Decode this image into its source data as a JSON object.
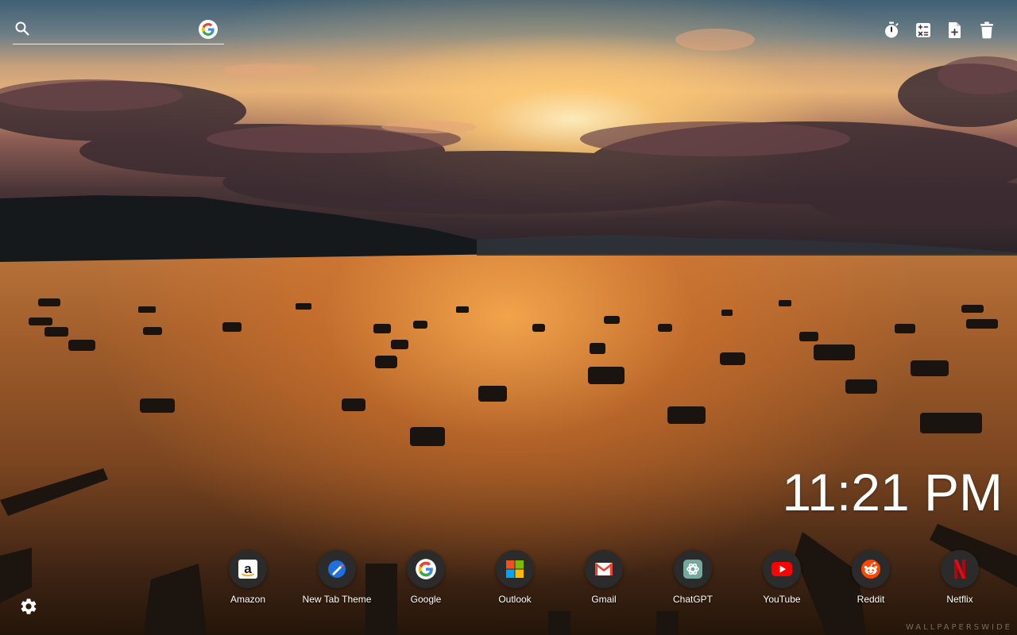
{
  "search": {
    "placeholder": "",
    "value": "",
    "engine_icon": "google-g-icon"
  },
  "toolbar": {
    "items": [
      {
        "icon": "stopwatch-icon"
      },
      {
        "icon": "calculator-icon"
      },
      {
        "icon": "add-note-icon"
      },
      {
        "icon": "trash-icon"
      }
    ]
  },
  "clock": {
    "time": "11:21 PM"
  },
  "shortcuts": [
    {
      "label": "Amazon",
      "icon": "amazon-icon"
    },
    {
      "label": "New Tab Theme",
      "icon": "new-tab-theme-icon"
    },
    {
      "label": "Google",
      "icon": "google-icon"
    },
    {
      "label": "Outlook",
      "icon": "outlook-icon"
    },
    {
      "label": "Gmail",
      "icon": "gmail-icon"
    },
    {
      "label": "ChatGPT",
      "icon": "chatgpt-icon"
    },
    {
      "label": "YouTube",
      "icon": "youtube-icon"
    },
    {
      "label": "Reddit",
      "icon": "reddit-icon"
    },
    {
      "label": "Netflix",
      "icon": "netflix-icon"
    }
  ],
  "settings": {
    "icon": "gear-icon"
  },
  "wallpaper": {
    "watermark": "WALLPAPERSWIDE"
  },
  "colors": {
    "shortcut_bg": "#2b2b2b",
    "youtube_red": "#ff0000",
    "reddit_orange": "#ff4500",
    "netflix_red": "#e50914",
    "chatgpt_green": "#74aa9c"
  }
}
